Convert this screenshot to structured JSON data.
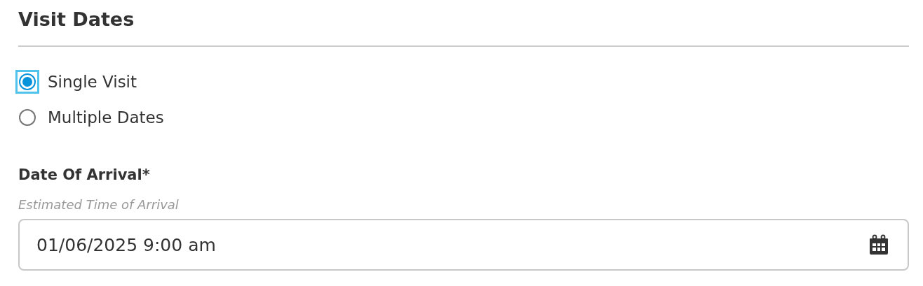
{
  "section": {
    "title": "Visit Dates"
  },
  "visit_options": [
    {
      "label": "Single Visit",
      "selected": true,
      "focused": true
    },
    {
      "label": "Multiple Dates",
      "selected": false,
      "focused": false
    }
  ],
  "arrival_field": {
    "label": "Date Of Arrival*",
    "hint": "Estimated Time of Arrival",
    "value": "01/06/2025 9:00 am"
  }
}
